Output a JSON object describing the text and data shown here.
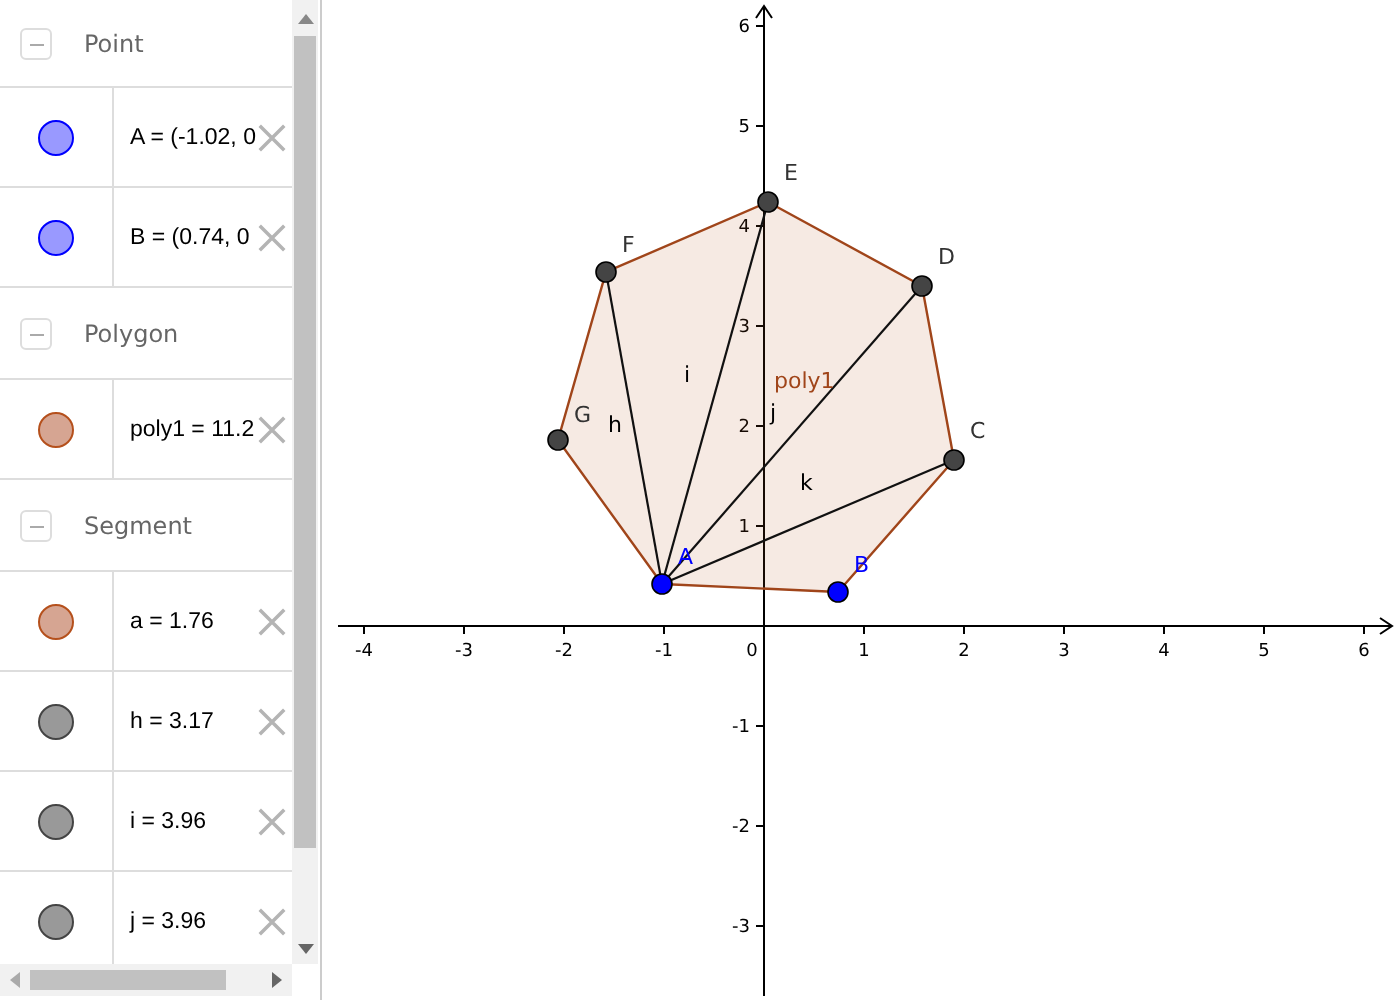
{
  "algebra": {
    "groups": [
      {
        "title": "Point",
        "expanded": true,
        "items": [
          {
            "text": "A = (-1.02, 0",
            "color": "#9999ff"
          },
          {
            "text": "B = (0.74, 0",
            "color": "#9999ff"
          }
        ]
      },
      {
        "title": "Polygon",
        "expanded": true,
        "items": [
          {
            "text": "poly1 = 11.2",
            "color": "#d6a592"
          }
        ]
      },
      {
        "title": "Segment",
        "expanded": true,
        "items": [
          {
            "text": "a = 1.76",
            "color": "#d6a592"
          },
          {
            "text": "h = 3.17",
            "color": "#999999"
          },
          {
            "text": "i = 3.96",
            "color": "#999999"
          },
          {
            "text": "j = 3.96",
            "color": "#999999"
          }
        ]
      }
    ]
  },
  "graphics": {
    "x_ticks": [
      "-4",
      "-3",
      "-2",
      "-1",
      "0",
      "1",
      "2",
      "3",
      "4",
      "5",
      "6"
    ],
    "y_ticks": [
      "6",
      "5",
      "4",
      "3",
      "2",
      "1",
      "-1",
      "-2",
      "-3"
    ],
    "polygon_label": "poly1",
    "points": [
      {
        "label": "A",
        "kind": "free"
      },
      {
        "label": "B",
        "kind": "free"
      },
      {
        "label": "C",
        "kind": "dependent"
      },
      {
        "label": "D",
        "kind": "dependent"
      },
      {
        "label": "E",
        "kind": "dependent"
      },
      {
        "label": "F",
        "kind": "dependent"
      },
      {
        "label": "G",
        "kind": "dependent"
      }
    ],
    "segments": [
      {
        "label": "h"
      },
      {
        "label": "i"
      },
      {
        "label": "j"
      },
      {
        "label": "k"
      }
    ]
  }
}
